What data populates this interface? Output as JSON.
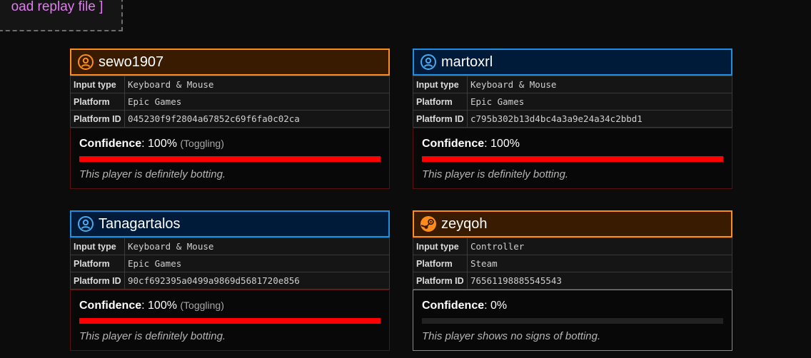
{
  "upload": {
    "label": "oad replay file ]"
  },
  "labels": {
    "input_type": "Input type",
    "platform": "Platform",
    "platform_id": "Platform ID",
    "confidence": "Confidence"
  },
  "colors": {
    "orange_accent": "#ff8c1a",
    "blue_accent": "#1c8fe0",
    "bar_red": "#ff0000"
  },
  "players": [
    {
      "name": "sewo1907",
      "theme": "orange",
      "icon": "user-circle-icon",
      "input_type": "Keyboard & Mouse",
      "platform": "Epic Games",
      "platform_id": "045230f9f2804a67852c69f6fa0c02ca",
      "confidence": "100%",
      "confidence_fraction": 1.0,
      "note": "(Toggling)",
      "verdict": "This player is definitely botting."
    },
    {
      "name": "martoxrl",
      "theme": "blue",
      "icon": "user-circle-icon",
      "input_type": "Keyboard & Mouse",
      "platform": "Epic Games",
      "platform_id": "c795b302b13d4bc4a3a9e24a34c2bbd1",
      "confidence": "100%",
      "confidence_fraction": 1.0,
      "note": "",
      "verdict": "This player is definitely botting."
    },
    {
      "name": "Tanagartalos",
      "theme": "blue",
      "icon": "user-circle-icon",
      "input_type": "Keyboard & Mouse",
      "platform": "Epic Games",
      "platform_id": "90cf692395a0499a9869d5681720e856",
      "confidence": "100%",
      "confidence_fraction": 1.0,
      "note": "(Toggling)",
      "verdict": "This player is definitely botting."
    },
    {
      "name": "zeyqoh",
      "theme": "orange",
      "icon": "steam-icon",
      "input_type": "Controller",
      "platform": "Steam",
      "platform_id": "76561198885545543",
      "confidence": "0%",
      "confidence_fraction": 0.0,
      "note": "",
      "verdict": "This player shows no signs of botting."
    }
  ]
}
